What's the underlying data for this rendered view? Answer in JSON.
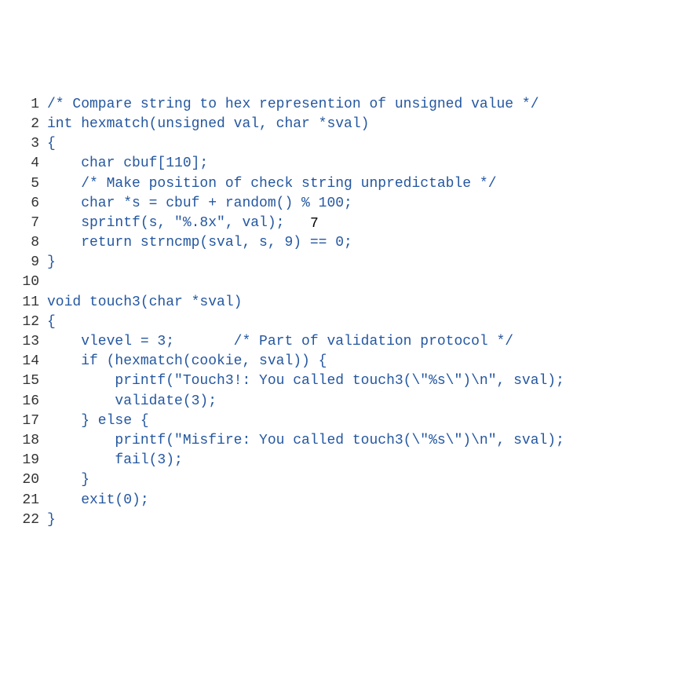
{
  "code": {
    "lines": [
      {
        "n": "1",
        "t": "/* Compare string to hex represention of unsigned value */"
      },
      {
        "n": "2",
        "t": "int hexmatch(unsigned val, char *sval)"
      },
      {
        "n": "3",
        "t": "{"
      },
      {
        "n": "4",
        "t": "    char cbuf[110];"
      },
      {
        "n": "5",
        "t": "    /* Make position of check string unpredictable */"
      },
      {
        "n": "6",
        "t": "    char *s = cbuf + random() % 100;"
      },
      {
        "n": "7",
        "t": "    sprintf(s, \"%.8x\", val);"
      },
      {
        "n": "8",
        "t": "    return strncmp(sval, s, 9) == 0;"
      },
      {
        "n": "9",
        "t": "}"
      },
      {
        "n": "10",
        "t": ""
      },
      {
        "n": "11",
        "t": "void touch3(char *sval)"
      },
      {
        "n": "12",
        "t": "{"
      },
      {
        "n": "13",
        "t": "    vlevel = 3;       /* Part of validation protocol */"
      },
      {
        "n": "14",
        "t": "    if (hexmatch(cookie, sval)) {"
      },
      {
        "n": "15",
        "t": "        printf(\"Touch3!: You called touch3(\\\"%s\\\")\\n\", sval);"
      },
      {
        "n": "16",
        "t": "        validate(3);"
      },
      {
        "n": "17",
        "t": "    } else {"
      },
      {
        "n": "18",
        "t": "        printf(\"Misfire: You called touch3(\\\"%s\\\")\\n\", sval);"
      },
      {
        "n": "19",
        "t": "        fail(3);"
      },
      {
        "n": "20",
        "t": "    }"
      },
      {
        "n": "21",
        "t": "    exit(0);"
      },
      {
        "n": "22",
        "t": "}"
      }
    ]
  },
  "overlay": "7"
}
